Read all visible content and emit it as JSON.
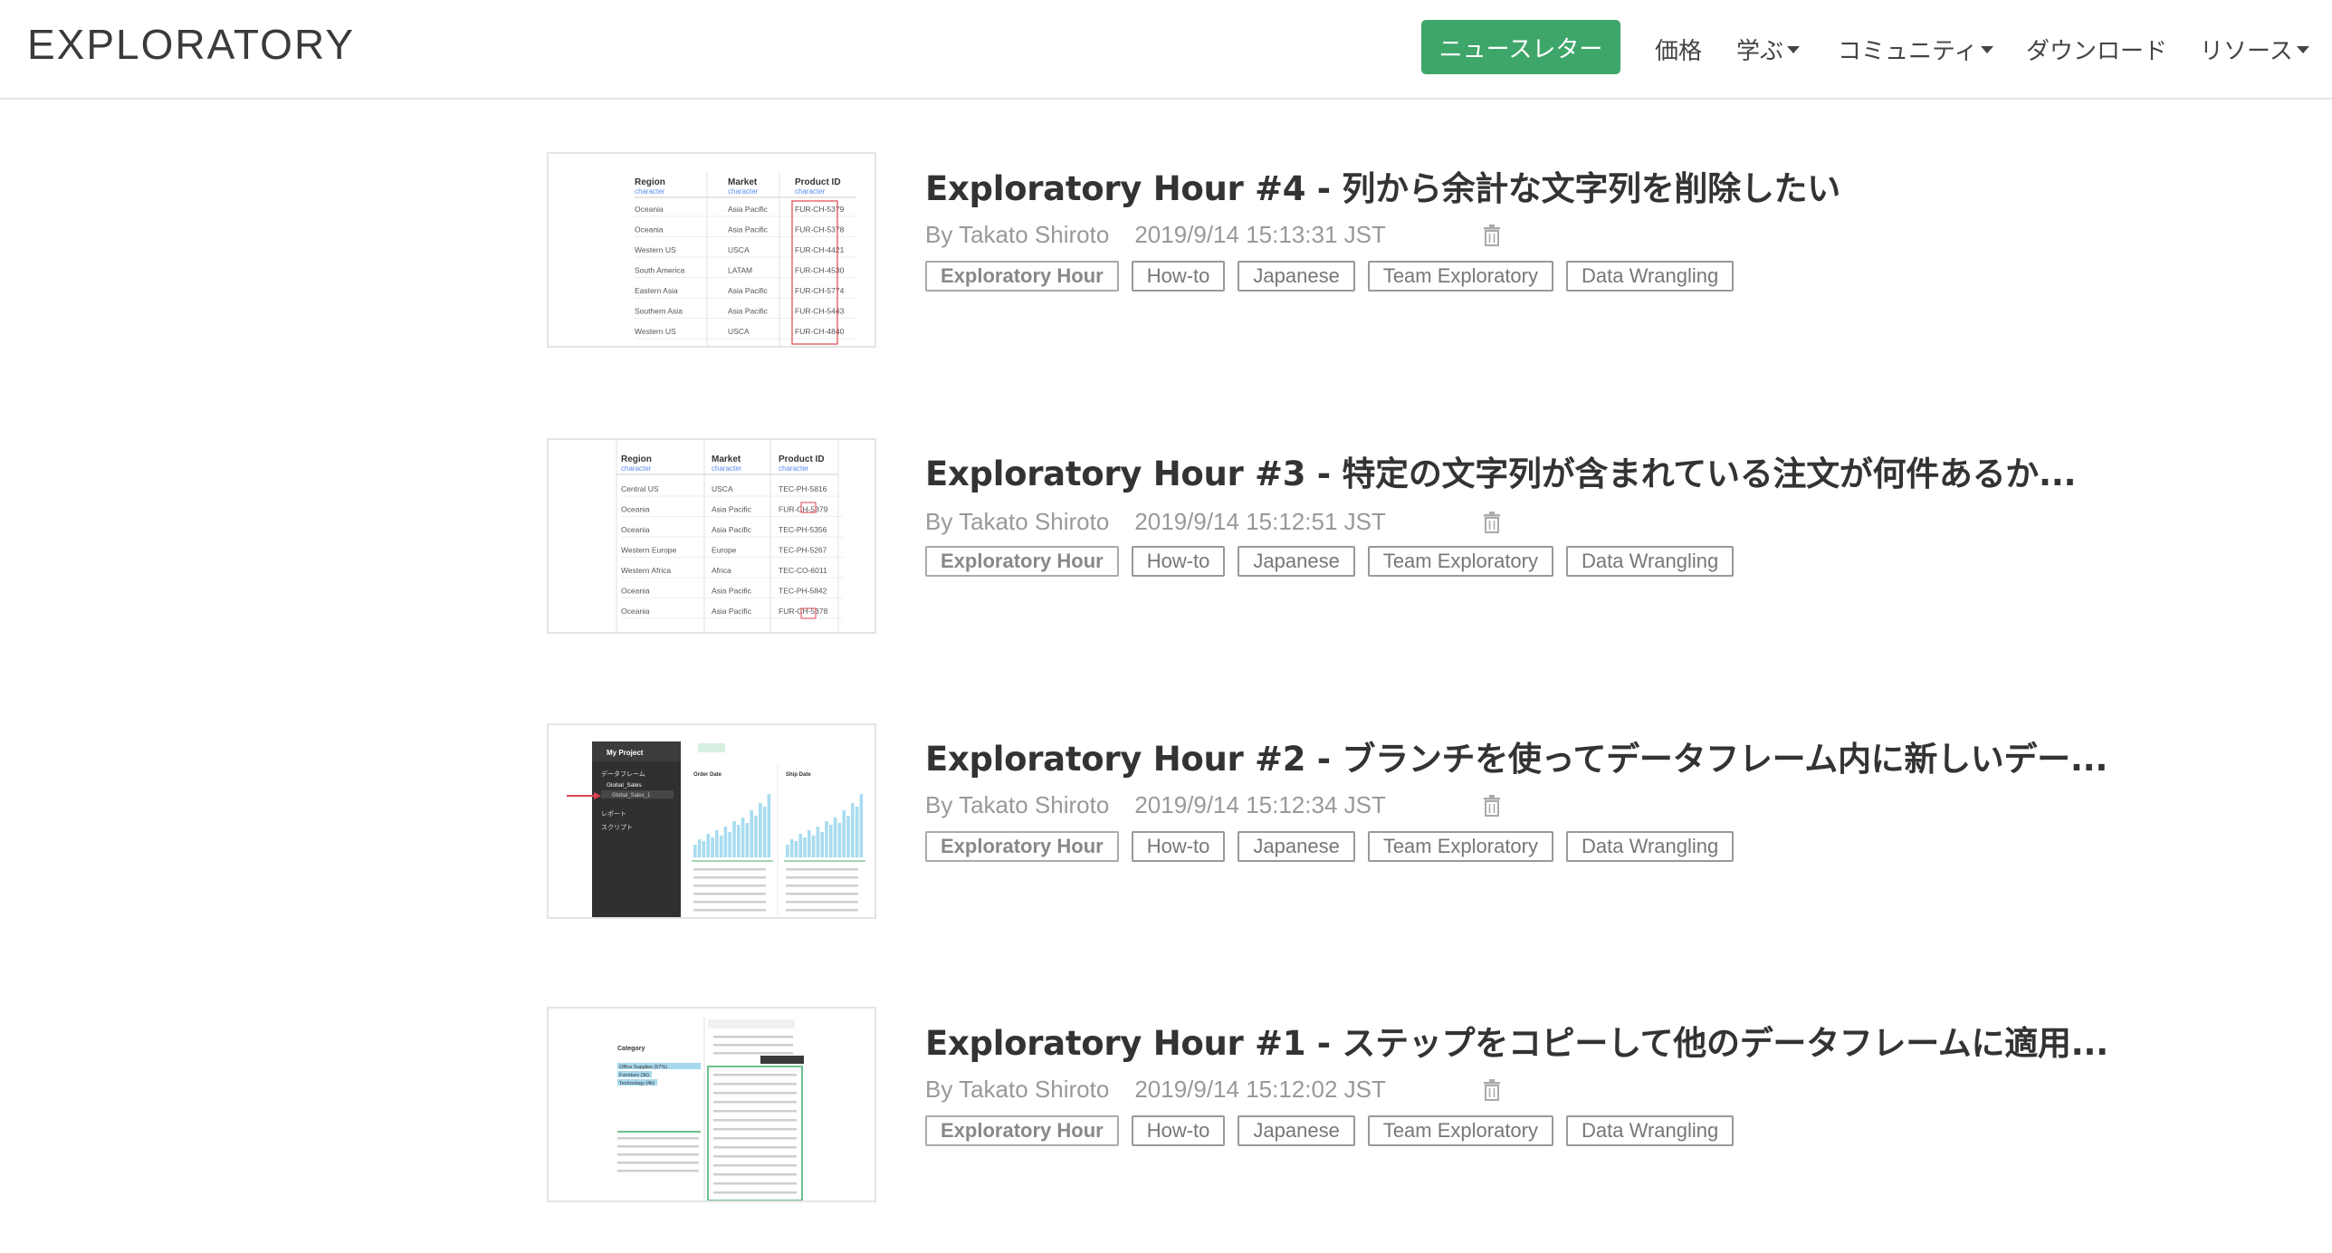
{
  "header": {
    "logo": "EXPLORATORY",
    "newsletter_label": "ニュースレター",
    "nav": [
      {
        "label": "価格",
        "dropdown": false
      },
      {
        "label": "学ぶ",
        "dropdown": true
      },
      {
        "label": "コミュニティ",
        "dropdown": true
      },
      {
        "label": "ダウンロード",
        "dropdown": false
      },
      {
        "label": "リソース",
        "dropdown": true
      }
    ]
  },
  "colors": {
    "accent": "#3fa66a",
    "highlight": "#e0434f"
  },
  "posts": [
    {
      "title": "Exploratory Hour #4 - 列から余計な文字列を削除したい",
      "author": "By Takato Shiroto",
      "date": "2019/9/14 15:13:31 JST",
      "tags": [
        "Exploratory Hour",
        "How-to",
        "Japanese",
        "Team Exploratory",
        "Data Wrangling"
      ],
      "thumb": {
        "headers": [
          "Region",
          "Market",
          "Product ID"
        ],
        "type_label": "character",
        "rows": [
          [
            "Oceania",
            "Asia Pacific",
            "FUR-CH-5379"
          ],
          [
            "Oceania",
            "Asia Pacific",
            "FUR-CH-5378"
          ],
          [
            "Western US",
            "USCA",
            "FUR-CH-4421"
          ],
          [
            "South America",
            "LATAM",
            "FUR-CH-4530"
          ],
          [
            "Eastern Asia",
            "Asia Pacific",
            "FUR-CH-5774"
          ],
          [
            "Southern Asia",
            "Asia Pacific",
            "FUR-CH-5443"
          ],
          [
            "Western US",
            "USCA",
            "FUR-CH-4840"
          ]
        ]
      }
    },
    {
      "title": "Exploratory Hour #3 - 特定の文字列が含まれている注文が何件あるか...",
      "author": "By Takato Shiroto",
      "date": "2019/9/14 15:12:51 JST",
      "tags": [
        "Exploratory Hour",
        "How-to",
        "Japanese",
        "Team Exploratory",
        "Data Wrangling"
      ],
      "thumb": {
        "headers": [
          "Region",
          "Market",
          "Product ID"
        ],
        "type_label": "character",
        "rows": [
          [
            "Central US",
            "USCA",
            "TEC-PH-5816"
          ],
          [
            "Oceania",
            "Asia Pacific",
            "FUR-CH-5379"
          ],
          [
            "Oceania",
            "Asia Pacific",
            "TEC-PH-5356"
          ],
          [
            "Western Europe",
            "Europe",
            "TEC-PH-5267"
          ],
          [
            "Western Africa",
            "Africa",
            "TEC-CO-6011"
          ],
          [
            "Oceania",
            "Asia Pacific",
            "TEC-PH-5842"
          ],
          [
            "Oceania",
            "Asia Pacific",
            "FUR-CH-5378"
          ]
        ]
      }
    },
    {
      "title": "Exploratory Hour #2 - ブランチを使ってデータフレーム内に新しいデー...",
      "author": "By Takato Shiroto",
      "date": "2019/9/14 15:12:34 JST",
      "tags": [
        "Exploratory Hour",
        "How-to",
        "Japanese",
        "Team Exploratory",
        "Data Wrangling"
      ],
      "thumb": {
        "project": "My Project",
        "side_items": [
          "データフレーム",
          "Global_Sales",
          "Global_Sales_1",
          "レポート",
          "スクリプト"
        ],
        "col1": "Order Date",
        "col2": "Ship Date"
      }
    },
    {
      "title": "Exploratory Hour #1 - ステップをコピーして他のデータフレームに適用...",
      "author": "By Takato Shiroto",
      "date": "2019/9/14 15:12:02 JST",
      "tags": [
        "Exploratory Hour",
        "How-to",
        "Japanese",
        "Team Exploratory",
        "Data Wrangling"
      ],
      "thumb": {
        "category": "Category",
        "items": [
          "Office Supplies (57%)",
          "Furniture (3k)",
          "Technology (4k)"
        ]
      }
    }
  ]
}
